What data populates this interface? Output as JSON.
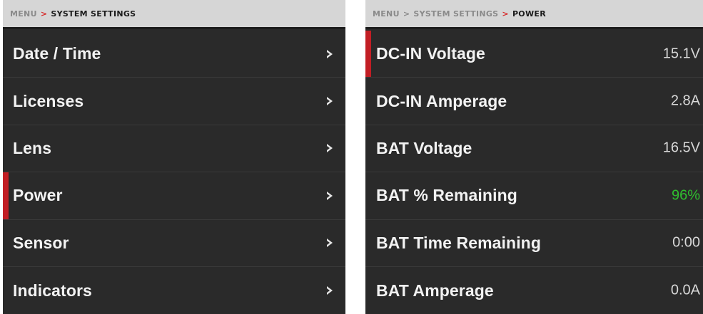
{
  "left_panel": {
    "breadcrumb": {
      "root": "MENU",
      "sep": ">",
      "current": "SYSTEM SETTINGS"
    },
    "items": [
      {
        "label": "Date / Time",
        "icon": "chevron-right-icon",
        "selected": false
      },
      {
        "label": "Licenses",
        "icon": "chevron-right-icon",
        "selected": false
      },
      {
        "label": "Lens",
        "icon": "chevron-right-icon",
        "selected": false
      },
      {
        "label": "Power",
        "icon": "chevron-right-icon",
        "selected": true
      },
      {
        "label": "Sensor",
        "icon": "chevron-right-icon",
        "selected": false
      },
      {
        "label": "Indicators",
        "icon": "chevron-right-icon",
        "selected": false
      }
    ]
  },
  "right_panel": {
    "breadcrumb": {
      "root": "MENU",
      "sep1": ">",
      "mid": "SYSTEM SETTINGS",
      "sep2": ">",
      "current": "POWER"
    },
    "items": [
      {
        "label": "DC-IN Voltage",
        "value": "15.1V",
        "selected": true
      },
      {
        "label": "DC-IN Amperage",
        "value": "2.8A",
        "selected": false
      },
      {
        "label": "BAT Voltage",
        "value": "16.5V",
        "selected": false
      },
      {
        "label": "BAT % Remaining",
        "value": "96%",
        "selected": false,
        "value_color": "#2fbf2f"
      },
      {
        "label": "BAT Time Remaining",
        "value": "0:00",
        "selected": false
      },
      {
        "label": "BAT Amperage",
        "value": "0.0A",
        "selected": false
      }
    ]
  },
  "colors": {
    "background": "#2a2a2a",
    "breadcrumb_bg": "#d6d6d6",
    "accent_red": "#c21e24",
    "text": "#f2f2f2",
    "value_ok": "#2fbf2f"
  }
}
